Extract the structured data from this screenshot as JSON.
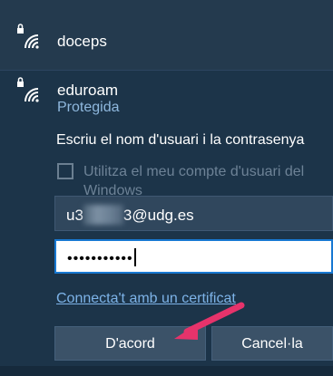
{
  "networks": [
    {
      "name": "doceps"
    },
    {
      "name": "eduroam",
      "status": "Protegida"
    }
  ],
  "login": {
    "prompt": "Escriu el nom d'usuari i la contrasenya",
    "checkbox_label": "Utilitza el meu compte d'usuari del Windows",
    "checkbox_checked": false,
    "username_prefix": "u3",
    "username_suffix": "3@udg.es",
    "password_masked": "•••••••••••",
    "cert_link": "Connecta't amb un certificat",
    "ok_label": "D'acord",
    "cancel_label": "Cancel·la"
  },
  "colors": {
    "accent": "#1778d2",
    "annotation_arrow": "#e6336b",
    "link": "#7db3e8"
  }
}
